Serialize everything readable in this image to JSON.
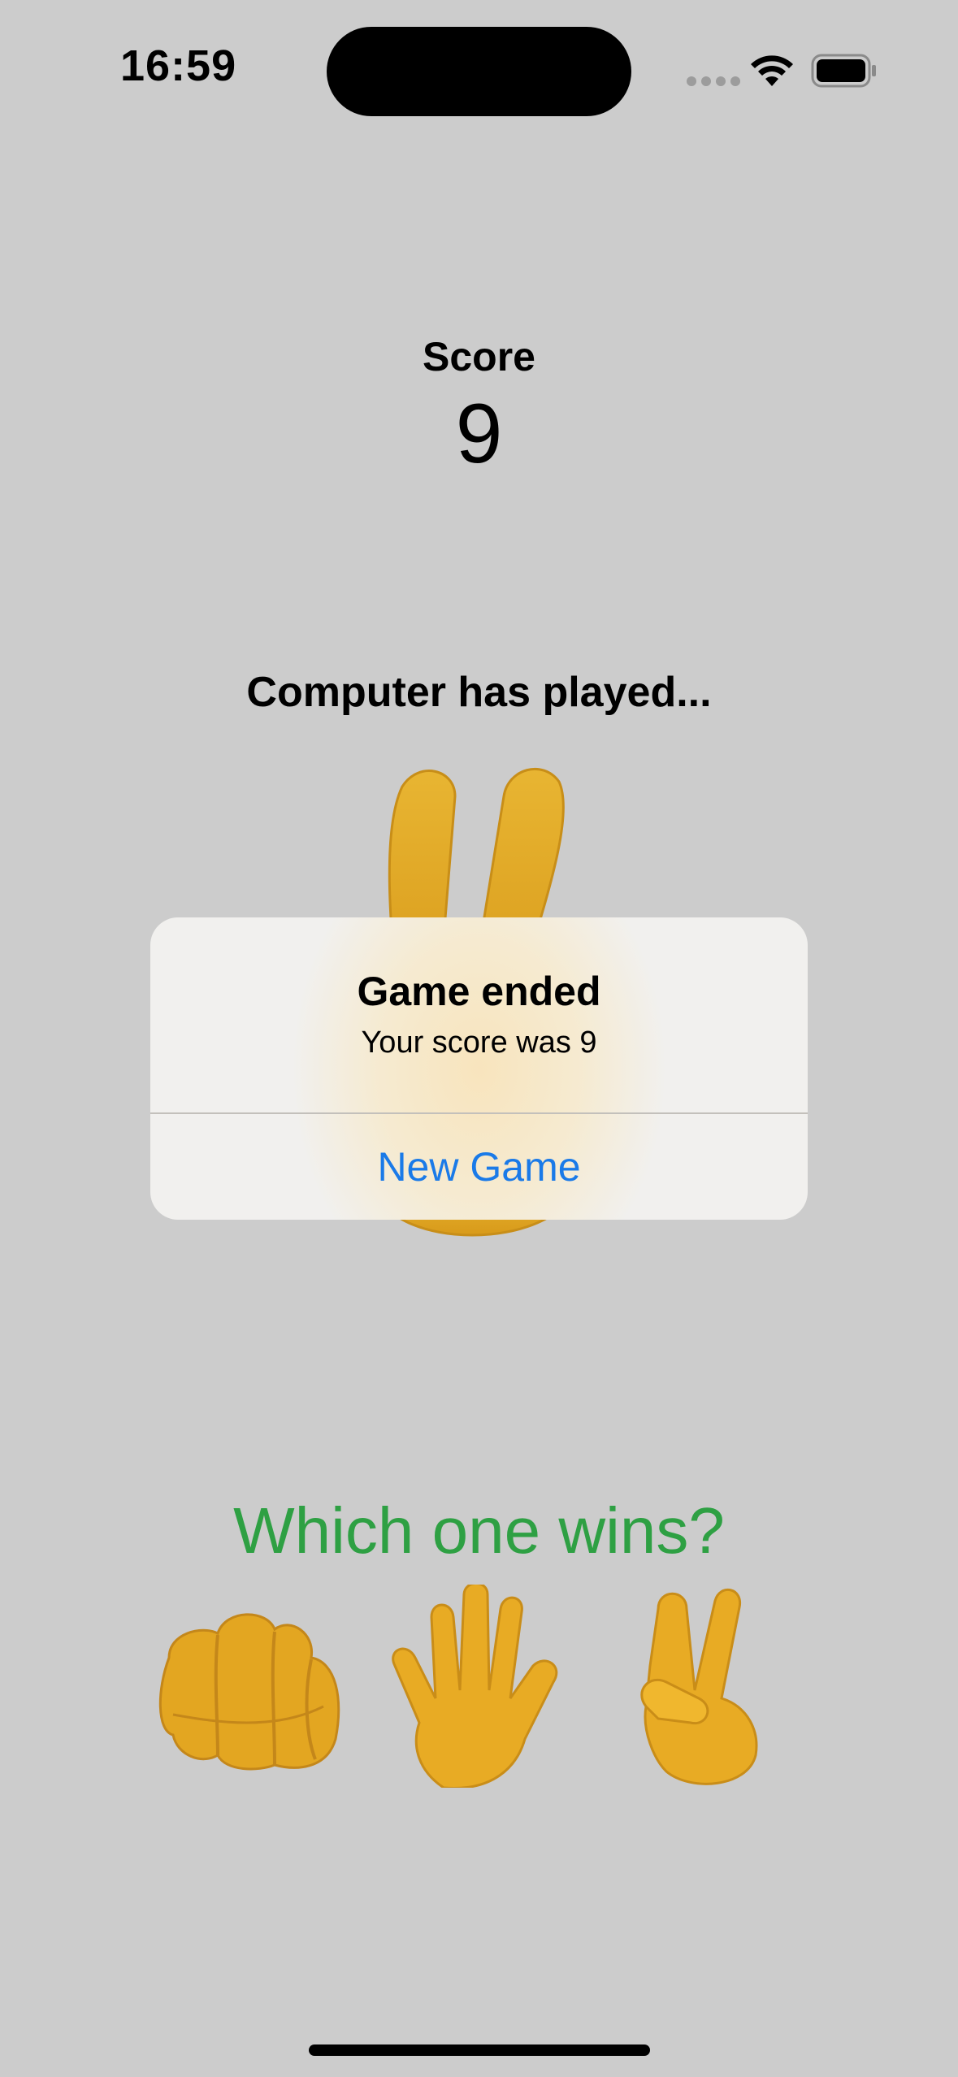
{
  "status_bar": {
    "time": "16:59",
    "icons": [
      "cellular-signal-icon",
      "wifi-icon",
      "battery-icon"
    ]
  },
  "score": {
    "label": "Score",
    "value": "9"
  },
  "computer": {
    "label": "Computer has played...",
    "move_icon": "victory-hand-icon"
  },
  "alert": {
    "title": "Game ended",
    "message": "Your score was 9",
    "button_label": "New Game"
  },
  "prompt": {
    "question": "Which one wins?"
  },
  "choices": [
    {
      "icon": "oncoming-fist-icon"
    },
    {
      "icon": "raised-hand-icon"
    },
    {
      "icon": "victory-hand-icon"
    }
  ],
  "colors": {
    "background": "#cccccc",
    "question_green": "#2ea043",
    "button_blue": "#1a7ae8",
    "emoji_yellow": "#e8a920"
  }
}
